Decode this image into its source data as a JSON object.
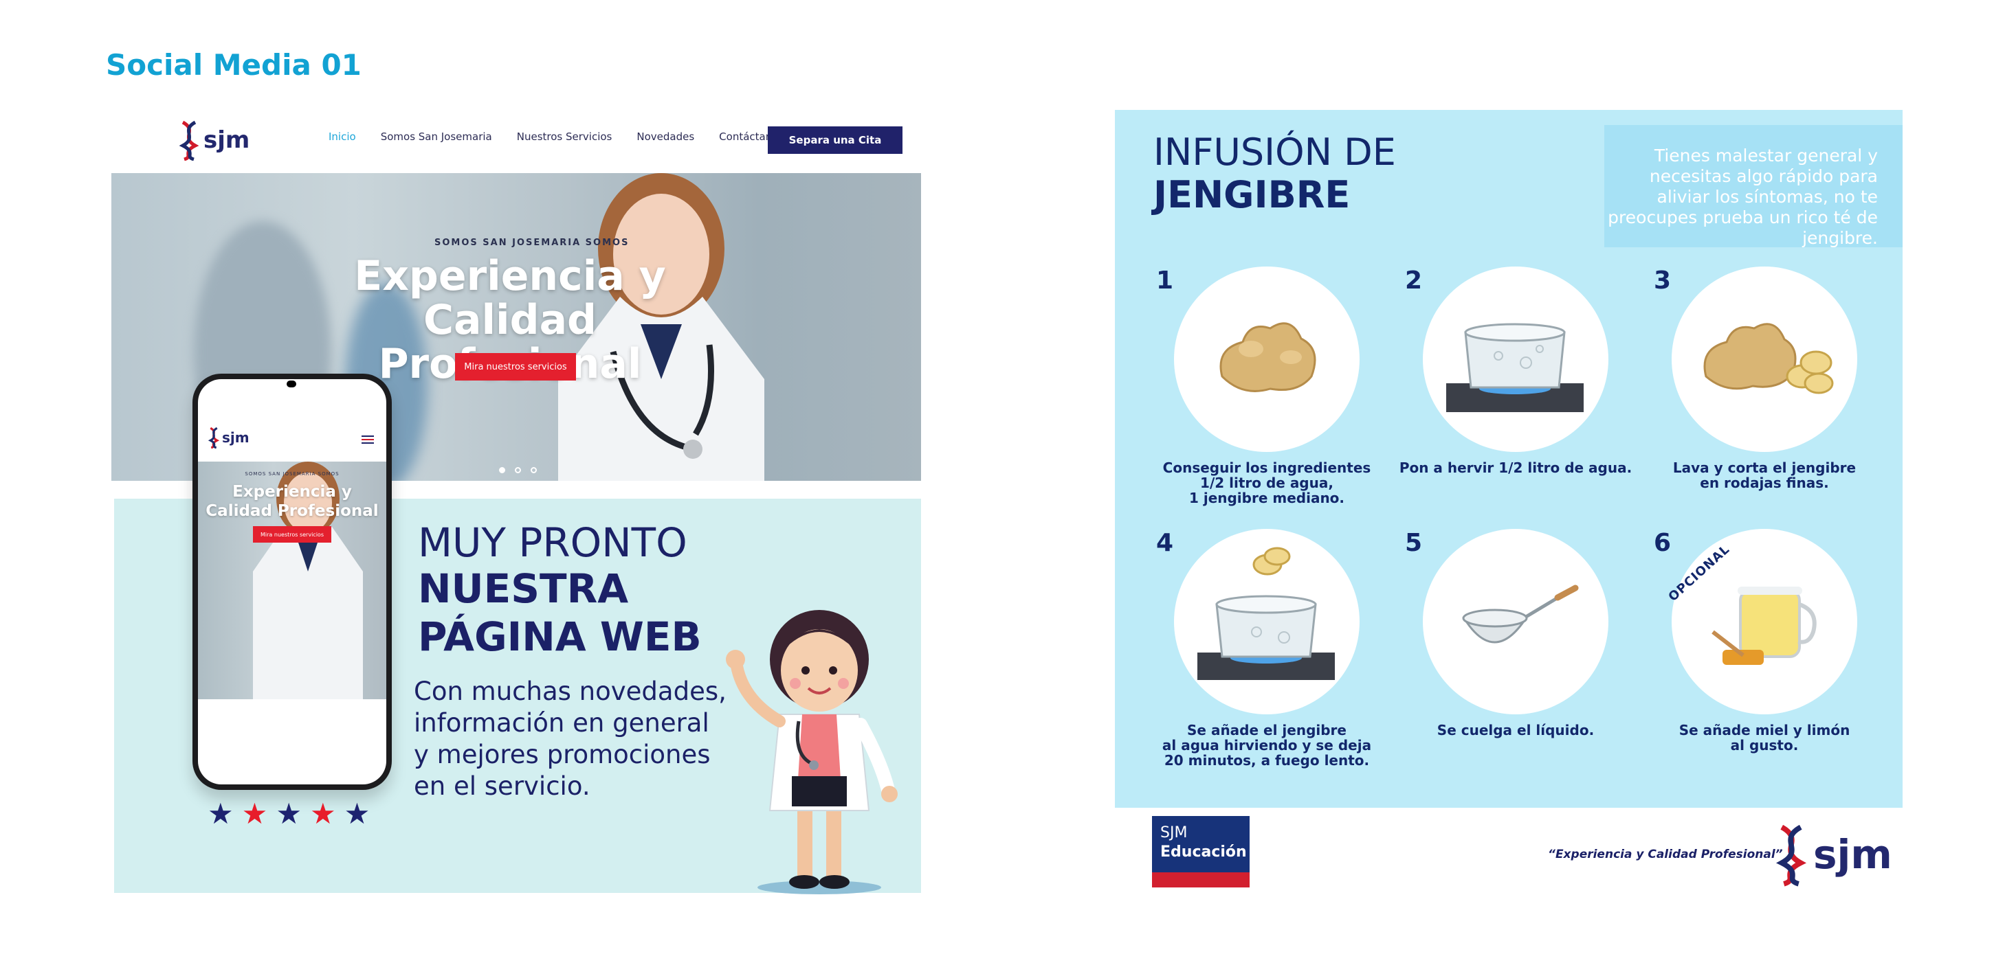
{
  "page": {
    "heading": "Social Media 01"
  },
  "left_card": {
    "logo_text": "sjm",
    "nav": [
      {
        "label": "Inicio",
        "active": true
      },
      {
        "label": "Somos San Josemaria",
        "active": false
      },
      {
        "label": "Nuestros Servicios",
        "active": false
      },
      {
        "label": "Novedades",
        "active": false
      },
      {
        "label": "Contáctanos",
        "active": false
      }
    ],
    "cta_label": "Separa una Cita",
    "hero": {
      "eyebrow": "SOMOS SAN JOSEMARIA SOMOS",
      "title_line1": "Experiencia y",
      "title_line2": "Calidad Profesional",
      "button_label": "Mira nuestros servicios",
      "slide_count": 3,
      "active_slide": 2
    },
    "phone": {
      "logo_text": "sjm",
      "eyebrow": "SOMOS SAN JOSEMARIA SOMOS",
      "title_line1": "Experiencia y",
      "title_line2": "Calidad Profesional",
      "button_label": "Mira nuestros servicios"
    },
    "promo": {
      "line1": "MUY PRONTO",
      "line2a": "NUESTRA",
      "line2b": "PÁGINA WEB",
      "body": "Con muchas novedades, información en general y mejores promociones en el servicio."
    },
    "rating": {
      "stars": [
        "navy",
        "red",
        "navy",
        "red",
        "navy"
      ],
      "colors": {
        "navy": "#1d2370",
        "red": "#e81c2a"
      }
    }
  },
  "right_card": {
    "title_line1": "INFUSIÓN DE",
    "title_line2": "JENGIBRE",
    "note": "Tienes malestar general y necesitas algo rápido para aliviar los síntomas, no te preocupes prueba un rico té de jengibre.",
    "steps": [
      {
        "number": "1",
        "caption": "Conseguir los ingredientes\n1/2 litro de agua,\n1 jengibre mediano.",
        "image": "ginger-root-icon"
      },
      {
        "number": "2",
        "caption": "Pon a hervir 1/2 litro de agua.",
        "image": "boiling-pot-icon"
      },
      {
        "number": "3",
        "caption": "Lava y corta el jengibre\nen rodajas finas.",
        "image": "sliced-ginger-icon"
      },
      {
        "number": "4",
        "caption": "Se añade el jengibre\nal agua hirviendo y se deja\n20 minutos, a fuego lento.",
        "image": "pot-with-ginger-icon"
      },
      {
        "number": "5",
        "caption": "Se cuelga el líquido.",
        "image": "strainer-icon"
      },
      {
        "number": "6",
        "caption": "Se añade miel y limón\nal gusto.",
        "image": "tea-honey-icon",
        "tag": "OPCIONAL"
      }
    ],
    "edu_line1": "SJM",
    "edu_line2": "Educación",
    "tagline": "“Experiencia y Calidad Profesional”",
    "logo_text": "sjm"
  },
  "colors": {
    "brand_navy": "#1b2167",
    "brand_red": "#d11a2a",
    "accent_blue": "#1ea6d9",
    "infographic_bg": "#bdebf8",
    "promo_bg": "#d3eff0"
  }
}
